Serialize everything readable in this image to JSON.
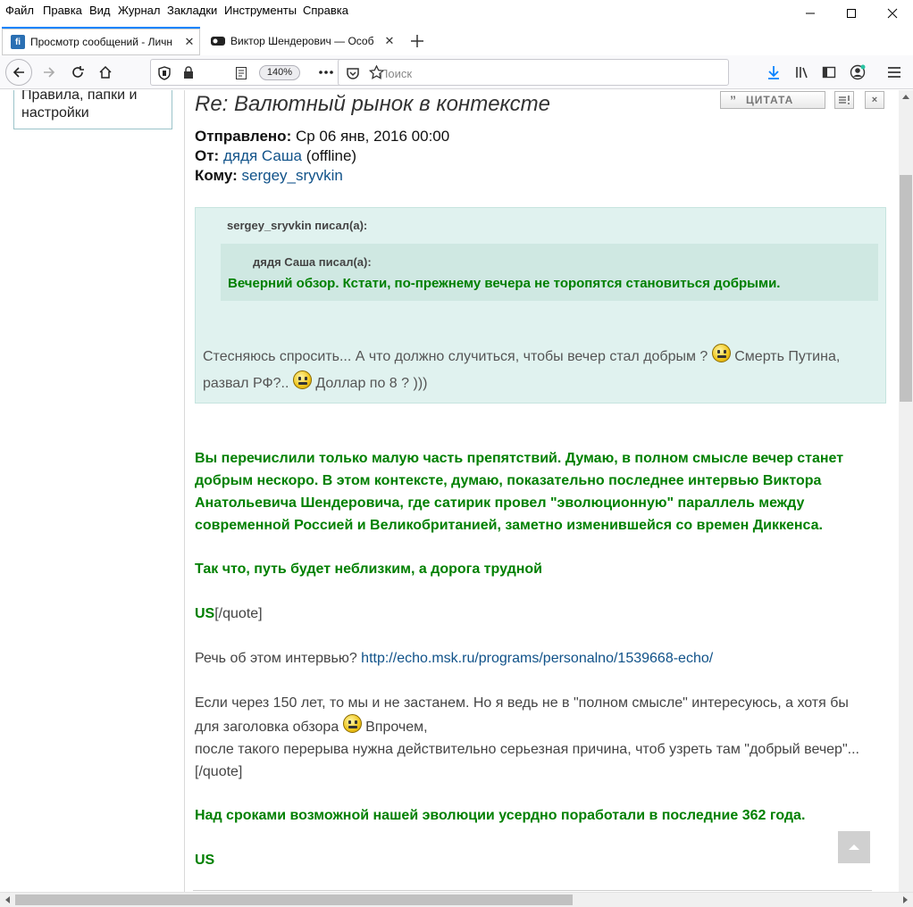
{
  "menu": {
    "items": [
      {
        "label": "Файл"
      },
      {
        "label": "Правка"
      },
      {
        "label": "Вид"
      },
      {
        "label": "Журнал"
      },
      {
        "label": "Закладки"
      },
      {
        "label": "Инструменты"
      },
      {
        "label": "Справка"
      }
    ]
  },
  "tabs": [
    {
      "title": "Просмотр сообщений - Личн",
      "favicon": "forum-favicon"
    },
    {
      "title": "Виктор Шендерович — Особ",
      "favicon": "echo-favicon"
    }
  ],
  "navbar": {
    "zoom": "140%",
    "search_placeholder": "Поиск"
  },
  "sidebar": {
    "box_text": "Правила, папки и настройки"
  },
  "post": {
    "title": "Re: Валютный рынок в контексте",
    "quote_button": "ЦИТАТА",
    "sent_label": "Отправлено:",
    "sent_value": "Ср 06 янв, 2016 00:00",
    "from_label": "От:",
    "from_user": "дядя Саша",
    "from_status": "(offline)",
    "to_label": "Кому:",
    "to_user": "sergey_sryvkin",
    "outer_quote_cite": "sergey_sryvkin писал(а):",
    "inner_quote_cite": "дядя Саша писал(а):",
    "inner_quote_text": "Вечерний обзор. Кстати, по-прежнему вечера не торопятся становиться добрыми.",
    "outer_quote_text_1": "Стесняюсь спросить... А что должно случиться, чтобы вечер стал добрым ?",
    "outer_quote_text_2": "Смерть Путина,",
    "outer_quote_text_3": "развал РФ?..",
    "outer_quote_text_4": "Доллар по 8 ? )))",
    "para1_line1": "Вы перечислили только малую часть препятствий. Думаю, в полном смысле вечер станет",
    "para1_line2": "добрым нескоро. В этом контексте, думаю, показательно последнее интервью Виктора",
    "para1_line3": "Анатольевича Шендеровича, где сатирик провел \"эволюционную\" параллель между",
    "para1_line4": "современной Россией и Великобританией, заметно изменившейся со времен Диккенса.",
    "para2": "Так что, путь будет неблизким, а дорога трудной",
    "sig1": "US",
    "endquote1": "[/quote]",
    "question": "Речь об этом интервью?",
    "link_url": "http://echo.msk.ru/programs/personalno/1539668-echo/",
    "reply_line1": "Если через 150 лет, то мы и не застанем. Но я ведь не в \"полном смысле\" интересуюсь, а хотя бы",
    "reply_line2a": "для заголовка обзора",
    "reply_line2b": "Впрочем,",
    "reply_line3": "после такого перерыва нужна действительно серьезная причина, чтоб узреть там \"добрый вечер\"...",
    "endquote2": "[/quote]",
    "para3": "Над сроками возможной нашей эволюции усердно поработали в последние 362 года.",
    "sig2": "US"
  }
}
